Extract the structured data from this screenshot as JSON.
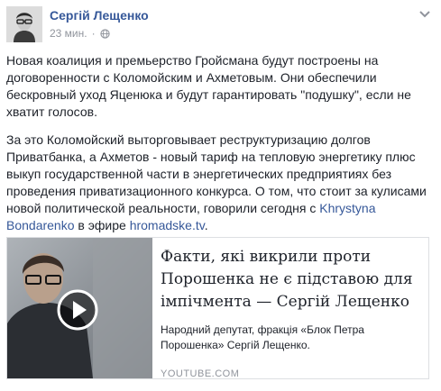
{
  "author": {
    "name": "Сергій Лещенко"
  },
  "meta": {
    "time": "23 мин.",
    "separator": "·"
  },
  "icons": {
    "avatar": "author-photo",
    "globe": "globe-icon",
    "menu": "chevron-down-icon",
    "play": "play-icon"
  },
  "post": {
    "p1": "Новая коалиция и премьерство Гройсмана будут построены на договоренности с Коломойским и Ахметовым. Они обеспечили бескровный уход Яценюка и будут гарантировать \"подушку\", если не хватит голосов.",
    "p2_before": "За это Коломойский выторговывает реструктуризацию долгов Приватбанка, а Ахметов - новый тариф на тепловую энергетику плюс выкуп государственной части в энергетических предприятиях без проведения приватизационного конкурса. О том, что стоит за кулисами новой политической реальности, говорили сегодня с ",
    "p2_link1": "Khrystyna Bondarenko",
    "p2_middle": " в эфире ",
    "p2_link2": "hromadske.tv",
    "p2_after": "."
  },
  "card": {
    "title": "Факти, які викрили проти Порошенка не є підставою для імпічмента — Сергій Лещенко",
    "description": "Народний депутат, фракція «Блок Петра Порошенка» Сергій Лещенко.",
    "source": "YOUTUBE.COM"
  },
  "colors": {
    "link": "#365899",
    "meta": "#90949c",
    "text": "#1d2129",
    "border": "#dddfe2"
  }
}
